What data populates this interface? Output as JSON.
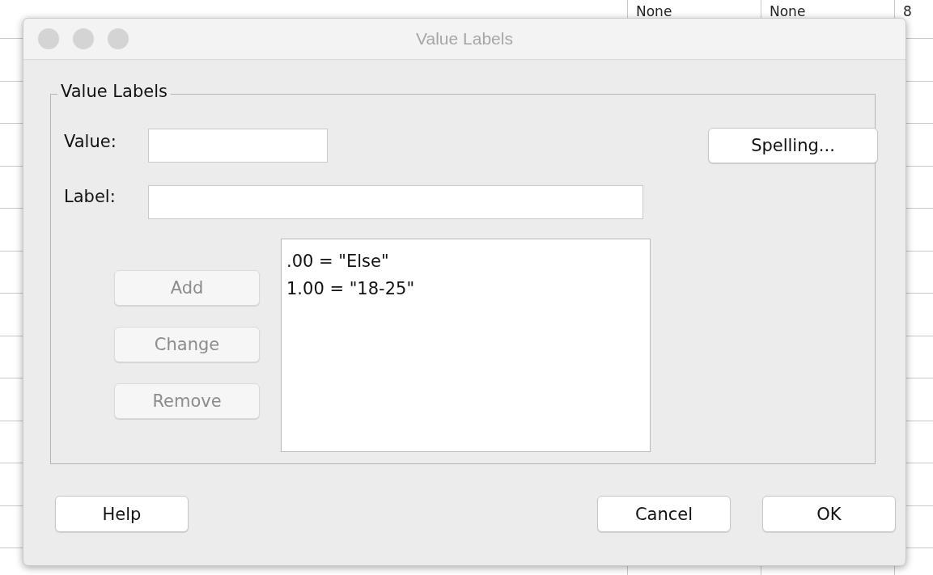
{
  "background_sheet": {
    "cells": [
      "None",
      "None",
      "8"
    ]
  },
  "window": {
    "title": "Value Labels"
  },
  "group": {
    "title": "Value Labels",
    "value_field": {
      "label": "Value:"
    },
    "label_field": {
      "label": "Label:"
    },
    "spelling_button": {
      "label": "Spelling...",
      "disabled": false
    },
    "action_buttons": [
      {
        "label": "Add",
        "disabled": true
      },
      {
        "label": "Change",
        "disabled": true
      },
      {
        "label": "Remove",
        "disabled": true
      }
    ],
    "labels_list": [
      {
        "text": ".00 = \"Else\"",
        "selected": false
      },
      {
        "text": "1.00 = \"18-25\"",
        "selected": false
      }
    ]
  },
  "buttons": [
    {
      "label": "Help",
      "disabled": false
    },
    {
      "label": "Cancel",
      "disabled": false
    },
    {
      "label": "OK",
      "disabled": false
    }
  ]
}
